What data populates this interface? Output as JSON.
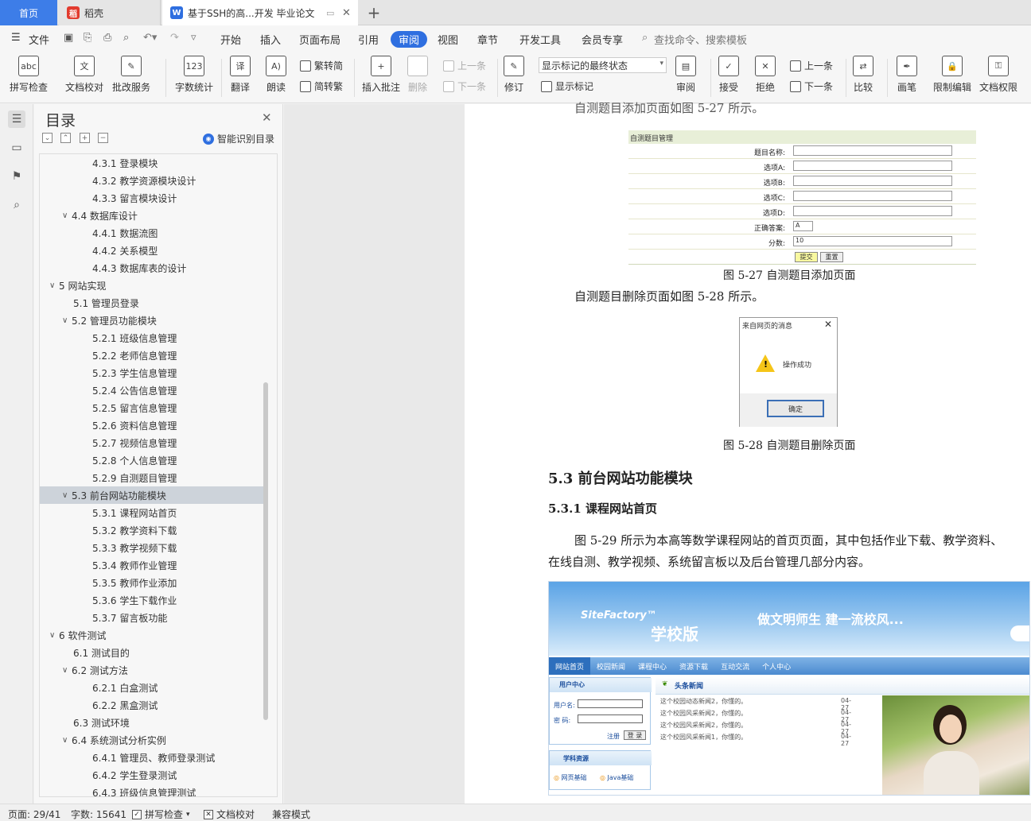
{
  "tabs": {
    "home": "首页",
    "daoke": "稻壳",
    "doc": "基于SSH的高...开发 毕业论文"
  },
  "menu": {
    "file": "文件",
    "items": [
      "开始",
      "插入",
      "页面布局",
      "引用",
      "审阅",
      "视图",
      "章节",
      "开发工具",
      "会员专享"
    ],
    "search": "查找命令、搜索模板"
  },
  "ribbon": {
    "spell": "拼写检查",
    "doccheck": "文档校对",
    "batch": "批改服务",
    "wordcount": "字数统计",
    "translate": "翻译",
    "read": "朗读",
    "trad": "繁转简",
    "simp": "简转繁",
    "insert_comment": "插入批注",
    "delete": "删除",
    "prev_comment": "上一条",
    "next_comment": "下一条",
    "revise": "修订",
    "show_mode": "显示标记的最终状态",
    "show_marks": "显示标记",
    "review": "审阅",
    "accept": "接受",
    "reject": "拒绝",
    "prev": "上一条",
    "next": "下一条",
    "compare": "比较",
    "pen": "画笔",
    "restrict": "限制编辑",
    "perm": "文档权限"
  },
  "toc": {
    "title": "目录",
    "smart": "智能识别目录",
    "items": [
      {
        "label": "4.3.1  登录模块",
        "level": 3
      },
      {
        "label": "4.3.2  教学资源模块设计",
        "level": 3
      },
      {
        "label": "4.3.3  留言模块设计",
        "level": 3
      },
      {
        "label": "4.4  数据库设计",
        "level": 2,
        "caret": true
      },
      {
        "label": "4.4.1  数据流图",
        "level": 3
      },
      {
        "label": "4.4.2  关系模型",
        "level": 3
      },
      {
        "label": "4.4.3  数据库表的设计",
        "level": 3
      },
      {
        "label": "5  网站实现",
        "level": 1,
        "caret": true
      },
      {
        "label": "5.1  管理员登录",
        "level": 2
      },
      {
        "label": "5.2  管理员功能模块",
        "level": 2,
        "caret": true
      },
      {
        "label": "5.2.1  班级信息管理",
        "level": 3
      },
      {
        "label": "5.2.2  老师信息管理",
        "level": 3
      },
      {
        "label": "5.2.3  学生信息管理",
        "level": 3
      },
      {
        "label": "5.2.4  公告信息管理",
        "level": 3
      },
      {
        "label": "5.2.5  留言信息管理",
        "level": 3
      },
      {
        "label": "5.2.6  资料信息管理",
        "level": 3
      },
      {
        "label": "5.2.7  视频信息管理",
        "level": 3
      },
      {
        "label": "5.2.8 个人信息管理",
        "level": 3
      },
      {
        "label": "5.2.9  自测题目管理",
        "level": 3
      },
      {
        "label": "5.3  前台网站功能模块",
        "level": 2,
        "caret": true,
        "selected": true
      },
      {
        "label": "5.3.1  课程网站首页",
        "level": 3
      },
      {
        "label": "5.3.2  教学资料下载",
        "level": 3
      },
      {
        "label": "5.3.3  教学视频下载",
        "level": 3
      },
      {
        "label": "5.3.4  教师作业管理",
        "level": 3
      },
      {
        "label": "5.3.5  教师作业添加",
        "level": 3
      },
      {
        "label": "5.3.6  学生下载作业",
        "level": 3
      },
      {
        "label": "5.3.7  留言板功能",
        "level": 3
      },
      {
        "label": "6  软件测试",
        "level": 1,
        "caret": true
      },
      {
        "label": "6.1  测试目的",
        "level": 2
      },
      {
        "label": "6.2  测试方法",
        "level": 2,
        "caret": true
      },
      {
        "label": "6.2.1  白盒测试",
        "level": 3
      },
      {
        "label": "6.2.2  黑盒测试",
        "level": 3
      },
      {
        "label": "6.3  测试环境",
        "level": 2
      },
      {
        "label": "6.4  系统测试分析实例",
        "level": 2,
        "caret": true
      },
      {
        "label": "6.4.1  管理员、教师登录测试",
        "level": 3
      },
      {
        "label": "6.4.2  学生登录测试",
        "level": 3
      },
      {
        "label": "6.4.3  班级信息管理测试",
        "level": 3
      }
    ]
  },
  "doc": {
    "top_cut": "自测题目添加页面如图 5-27 所示。",
    "fig27_header": "自测题目管理",
    "fig27_fields": [
      {
        "label": "题目名称:",
        "value": ""
      },
      {
        "label": "选项A:",
        "value": ""
      },
      {
        "label": "选项B:",
        "value": ""
      },
      {
        "label": "选项C:",
        "value": ""
      },
      {
        "label": "选项D:",
        "value": ""
      },
      {
        "label": "正确答案:",
        "value": "A"
      },
      {
        "label": "分数:",
        "value": "10"
      }
    ],
    "fig27_submit": "提交",
    "fig27_reset": "重置",
    "fig27_caption": "图 5-27  自测题目添加页面",
    "para_delete": "自测题目删除页面如图 5-28 所示。",
    "dlg_title": "来自网页的消息",
    "dlg_msg": "操作成功",
    "dlg_ok": "确定",
    "fig28_caption": "图 5-28  自测题目删除页面",
    "h_53": "5.3  前台网站功能模块",
    "h_531": "5.3.1  课程网站首页",
    "para1": "图 5-29 所示为本高等数学课程网站的首页页面，其中包括作业下载、教学资料、",
    "para2": "在线自测、教学视频、系统留言板以及后台管理几部分内容。",
    "site": {
      "brand": "SiteFactory™",
      "brand2": "学校版",
      "slogan": "做文明师生  建一流校风...",
      "nav": [
        "网站首页",
        "校园新闻",
        "课程中心",
        "资源下载",
        "互动交流",
        "个人中心"
      ],
      "user_center": "用户中心",
      "username": "用户名:",
      "password": "密  码:",
      "register": "注册",
      "login": "登 录",
      "news_title": "头条新闻",
      "news": [
        {
          "t": "这个校园动态新闻2，你懂的。",
          "d": "04-27"
        },
        {
          "t": "这个校园风采新闻2，你懂的。",
          "d": "04-27"
        },
        {
          "t": "这个校园风采新闻2，你懂的。",
          "d": "04-27"
        },
        {
          "t": "这个校园风采新闻1，你懂的。",
          "d": "04-27"
        }
      ],
      "subject": "学科资源",
      "links": [
        "网页基础",
        "Java基础"
      ]
    }
  },
  "status": {
    "page": "页面: 29/41",
    "words": "字数: 15641",
    "spell": "拼写检查",
    "doccheck": "文档校对",
    "compat": "兼容模式"
  }
}
